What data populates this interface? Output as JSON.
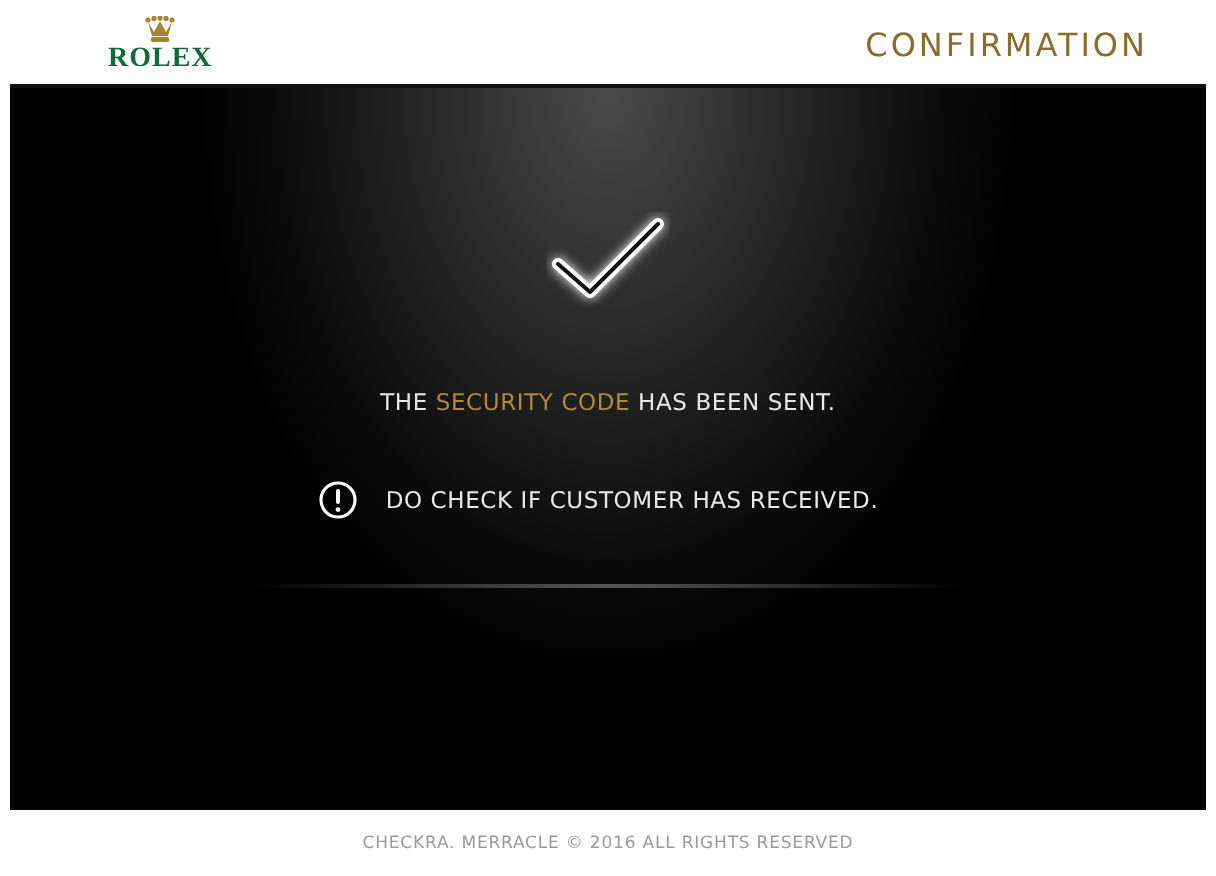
{
  "header": {
    "brand": "ROLEX",
    "title": "CONFIRMATION"
  },
  "panel": {
    "message": [
      {
        "text": "THE ",
        "highlight": false
      },
      {
        "text": "SECURITY CODE",
        "highlight": true
      },
      {
        "text": " HAS BEEN SENT.",
        "highlight": false
      }
    ],
    "notice": "DO CHECK IF CUSTOMER HAS RECEIVED."
  },
  "footer": "CHECKRA. MERRACLE © 2016 ALL RIGHTS RESERVED"
}
